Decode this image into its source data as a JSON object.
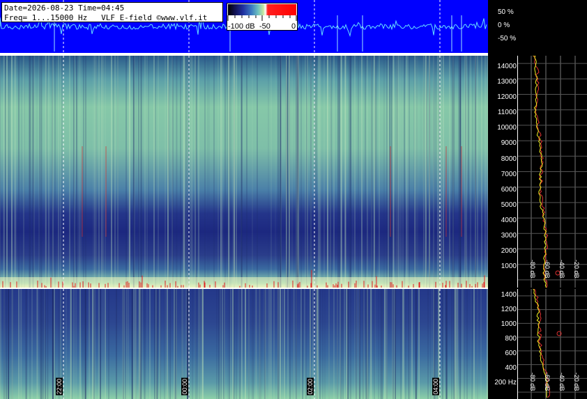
{
  "header": {
    "line1": "Date=2026-08-23 Time=04:45",
    "line2": "Freq= 1...15000 Hz   VLF E-field ©www.vlf.it"
  },
  "colorbar": {
    "min_label": "-100 dB",
    "mid_label": "-50",
    "max_label": "0"
  },
  "waveform": {
    "labels": [
      "50 %",
      "0 %",
      "-50 %"
    ]
  },
  "upper_freq_ticks": [
    "14000",
    "13000",
    "12000",
    "11000",
    "10000",
    "9000",
    "8000",
    "7000",
    "6000",
    "5000",
    "4000",
    "3000",
    "2000",
    "1000"
  ],
  "lower_freq_ticks": [
    "1400",
    "1200",
    "1000",
    "800",
    "600",
    "400",
    "200 Hz"
  ],
  "time_labels": [
    "22:00",
    "00:00",
    "02:00",
    "04:00"
  ],
  "db_labels": [
    "-80 dB",
    "-60 dB",
    "-40 dB",
    "-20 dB"
  ],
  "colors": {
    "waveform_bg": "#0000ff",
    "trace": "#66e0ff",
    "spec_dark": "#1a2a7a",
    "spec_light": "#9fd8a8",
    "marker": "#e02020"
  }
}
